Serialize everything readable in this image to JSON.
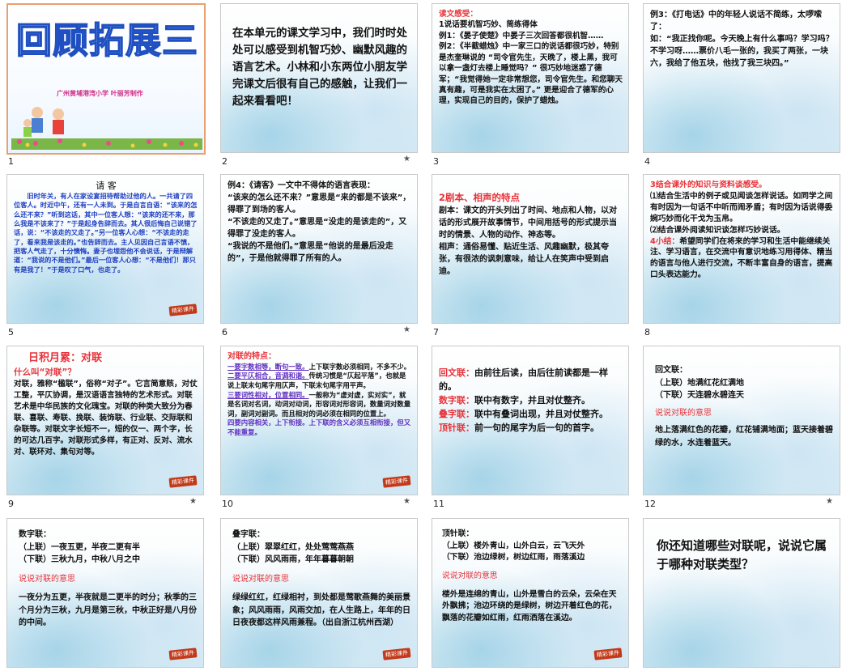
{
  "slides": [
    {
      "num": "1",
      "star": "",
      "title": "回顾拓展三",
      "credit": "广州黄埔港湾小学  叶丽芳制作"
    },
    {
      "num": "2",
      "star": "★",
      "text": "在本单元的课文学习中，我们时时处处可以感受到机智巧妙、幽默风趣的语言艺术。小林和小东两位小朋友学完课文后很有自己的感触，让我们一起来看看吧！"
    },
    {
      "num": "3",
      "star": "",
      "heading": "读文感受：",
      "lines": [
        "1说话要机智巧妙、简练得体",
        "例1：《晏子使楚》中晏子三次回答都很机智……",
        "例2：《半截蜡烛》中一家三口的说话都很巧妙，特别是杰奎琳说的 “司令官先生，天晚了，楼上黑，我可以拿一盏灯去楼上睡觉吗？” 很巧妙地迷惑了德军；“我觉得她一定非常想您，司令官先生。和您聊天真有趣，可是我实在太困了。” 更是迎合了德军的心理，实现自己的目的，保护了蜡烛。"
      ]
    },
    {
      "num": "4",
      "star": "",
      "text": "例3：《打电话》中的年轻人说话不简练，太啰嗦了：\n如：“我正找你呢。今天晚上有什么事吗？学习吗？不学习呀……票价八毛一张的，我买了两张，一块六，我给了他五块，他找了我三块四。”"
    },
    {
      "num": "5",
      "star": "",
      "heading": "请  客",
      "text": "旧时年关，有人在家设宴招待帮助过他的人。一共请了四位客人。时近中午，还有一人未到。于是自言自语：“该来的怎么还不来？”听到这话，其中一位客人想：“该来的还不来，那么我是不该来了？”于是起身告辞而去。其人很后悔自己说错了话，说：“不该走的又走了。”另一位客人心想：“不该走的走了，看来我是该走的。”也告辞而去。主人见因自己言语不慎，把客人气走了，十分懊悔。妻子也埋怨他不会说话，于是辩解道：“我说的不是他们。”最后一位客人心想：“不是他们！那只有是我了！”于是叹了口气，也走了。",
      "stamp": "精彩课件"
    },
    {
      "num": "6",
      "star": "★",
      "text": "例4：《请客》一文中不得体的语言表现：\n“该来的怎么还不来？”意思是“来的都是不该来”，得罪了到场的客人。\n“不该走的又走了。”意思是“没走的是该走的”，又得罪了没走的客人。\n“我说的不是他们。”意思是“他说的是最后没走的”，于是他就得罪了所有的人。"
    },
    {
      "num": "7",
      "star": "",
      "heading": "2剧本、相声的特点",
      "text": "剧本：课文的开头列出了时间、地点和人物，以对话的形式展开故事情节，中间用括号的形式提示当时的情景、人物的动作、神态等。\n相声：通俗易懂、贴近生活、风趣幽默，极其夸张，有很浓的讽刺意味，给让人在笑声中受到启迪。"
    },
    {
      "num": "8",
      "star": "",
      "heading": "3结合课外的知识与资料谈感受。",
      "text": "⑴结合生活中的例子或见闻谈怎样说话。如同学之间有时因为一句话不中听而闹矛盾；有时因为话说得委婉巧妙而化干戈为玉帛。\n⑵结合课外阅读知识谈怎样巧妙说话。",
      "heading2": "4小结：",
      "text2": "希望同学们在将来的学习和生活中能继续关注、学习语言，在交流中有意识地练习用得体、精当的语言与他人进行交流，不断丰富自身的语言，提高口头表达能力。"
    },
    {
      "num": "9",
      "star": "★",
      "heading": "日积月累：对联",
      "sub": "什么叫“对联”？",
      "text": "对联，雅称“楹联”，俗称“对子”。它言简意赅，对仗工整，平仄协调，是汉语语言独特的艺术形式。对联艺术是中华民族的文化瑰宝。对联的种类大致分为春联、喜联、寿联、挽联、装饰联、行业联、交际联和杂联等。对联文字长短不一，短的仅一、两个字，长的可达几百字。对联形式多样，有正对、反对、流水对、联环对、集句对等。",
      "stamp": "精彩课件"
    },
    {
      "num": "10",
      "star": "★",
      "heading": "对联的特点：",
      "points": [
        {
          "lead": "一要字数相等，断句一致。",
          "body": "上下联字数必须相同，不多不少。"
        },
        {
          "lead": "二要平仄相合，音调和谐。",
          "body": "传统习惯是“仄起平落”，也就是说上联末句尾字用仄声，下联末句尾字用平声。"
        },
        {
          "lead": "三要词性相对，位置相同。",
          "body": "一般称为“虚对虚，实对实”，就是名词对名词，动词对动词，形容词对形容词，数量词对数量词，副词对副词。而且相对的词必须在相同的位置上。"
        },
        {
          "lead": "四要内容相关，上下衔接。",
          "body": "上下联的含义必须互相衔接，但又不能重复。"
        }
      ],
      "stamp": "精彩课件"
    },
    {
      "num": "11",
      "star": "",
      "items": [
        {
          "label": "回文联：",
          "body": "由前往后读，由后往前读都是一样的。"
        },
        {
          "label": "数字联：",
          "body": "联中有数字，并且对仗整齐。"
        },
        {
          "label": "叠字联：",
          "body": "联中有叠词出现，并且对仗整齐。"
        },
        {
          "label": "顶针联：",
          "body": "前一句的尾字为后一句的首字。"
        }
      ]
    },
    {
      "num": "12",
      "star": "★",
      "heading": "回文联：",
      "lines": [
        "（上联）地满红花红满地",
        "（下联）天连碧水碧连天"
      ],
      "say": "说说对联的意思",
      "text": "地上落满红色的花瓣，红花铺满地面；蓝天接着碧绿的水，水连着蓝天。"
    },
    {
      "num": "",
      "star": "",
      "heading": "数字联：",
      "lines": [
        "（上联）一夜五更，半夜二更有半",
        "（下联）三秋九月，中秋八月之中"
      ],
      "say": "说说对联的意思",
      "text": "一夜分为五更，半夜就是二更半的时分；秋季的三个月分为三秋，九月是第三秋，中秋正好是八月份的中间。",
      "stamp": "精彩课件"
    },
    {
      "num": "",
      "star": "",
      "heading": "叠字联：",
      "lines": [
        "（上联）翠翠红红，处处莺莺燕燕",
        "（下联）风风雨雨，年年暮暮朝朝"
      ],
      "say": "说说对联的意思",
      "text": "绿绿红红，红绿相衬，到处都是莺歌燕舞的美丽景象；风风雨雨，风雨交加，在人生路上，年年的日日夜夜都这样风雨兼程。（出自浙江杭州西湖）",
      "stamp": "精彩课件"
    },
    {
      "num": "",
      "star": "",
      "heading": "顶针联：",
      "lines": [
        "（上联）楼外青山，山外白云，云飞天外",
        "（下联）池边绿树，树边红雨，雨落溪边"
      ],
      "say": "说说对联的意思",
      "text": "楼外是连绵的青山，山外是雪白的云朵，云朵在天外飘拂；池边环绕的是绿树，树边开着红色的花，飘落的花瓣如红雨，红雨洒落在溪边。",
      "stamp": "精彩课件"
    },
    {
      "num": "",
      "star": "",
      "text": "你还知道哪些对联呢，说说它属于哪种对联类型？"
    }
  ],
  "row_numbers": [
    "1",
    "2",
    "3",
    "4",
    "5",
    "6",
    "7",
    "8",
    "9",
    "10",
    "11",
    "12"
  ],
  "colors": {
    "accent_red": "#e8333a",
    "accent_blue": "#2040c0",
    "accent_purple": "#6030c0",
    "selected_border": "#e8a070"
  }
}
